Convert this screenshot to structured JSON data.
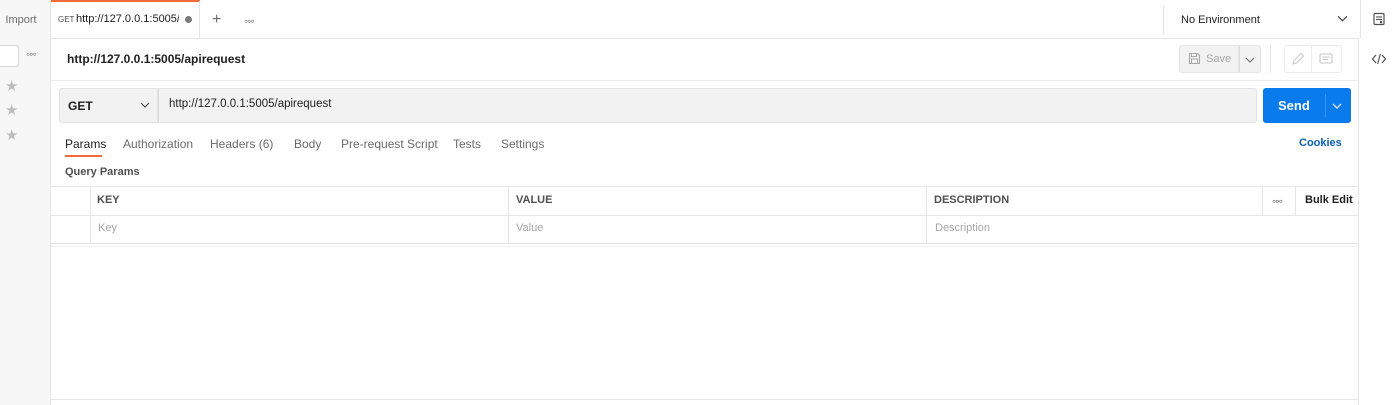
{
  "sidebar": {
    "import_label": "Import",
    "more_label": "◦◦◦",
    "favorite_glyph": "★"
  },
  "tabs": {
    "active": {
      "method": "GET",
      "url": "http://127.0.0.1:5005/apirequest",
      "unsaved": true
    },
    "new_tab_glyph": "+",
    "more_label": "◦◦◦"
  },
  "environment": {
    "selected": "No Environment"
  },
  "request": {
    "title": "http://127.0.0.1:5005/apirequest",
    "save_label": "Save",
    "method": "GET",
    "url": "http://127.0.0.1:5005/apirequest",
    "send_label": "Send"
  },
  "request_tabs": [
    {
      "label": "Params",
      "active": true
    },
    {
      "label": "Authorization",
      "active": false
    },
    {
      "label": "Headers (6)",
      "active": false
    },
    {
      "label": "Body",
      "active": false
    },
    {
      "label": "Pre-request Script",
      "active": false
    },
    {
      "label": "Tests",
      "active": false
    },
    {
      "label": "Settings",
      "active": false
    }
  ],
  "cookies_label": "Cookies",
  "params": {
    "section_label": "Query Params",
    "columns": [
      "KEY",
      "VALUE",
      "DESCRIPTION"
    ],
    "placeholders": [
      "Key",
      "Value",
      "Description"
    ],
    "more_label": "◦◦◦",
    "bulk_edit_label": "Bulk Edit"
  },
  "colors": {
    "accent": "#f26b3a",
    "send_button": "#097bed",
    "link": "#0b5fb0"
  },
  "icons": [
    "save-icon",
    "chevron-down-icon",
    "edit-icon",
    "comment-icon",
    "code-icon",
    "environment-quick-look-icon"
  ]
}
